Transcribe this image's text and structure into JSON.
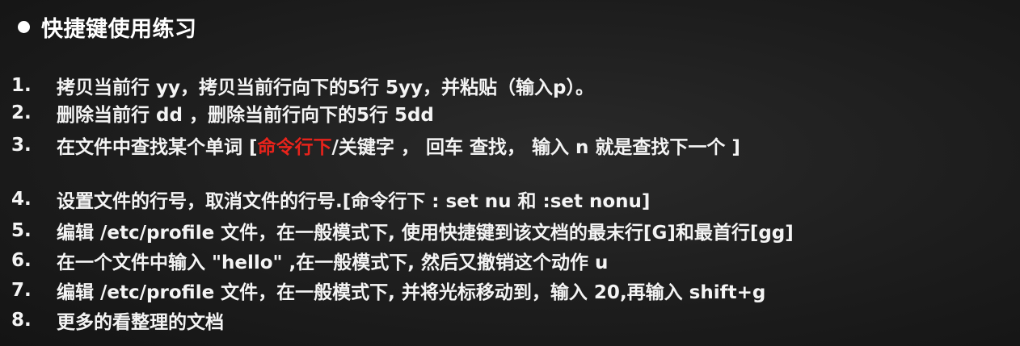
{
  "heading": "快捷键使用练习",
  "items": [
    {
      "num": "1.",
      "text": "拷贝当前行   yy，拷贝当前行向下的5行  5yy，并粘贴（输入p）。"
    },
    {
      "num": "2.",
      "text": "删除当前行  dd ，删除当前行向下的5行 5dd"
    },
    {
      "num": "3.",
      "text_before": "在文件中查找某个单词 [",
      "highlight": "命令行下",
      "text_after": " /关键字  ， 回车 查找， 输入 n 就是查找下一个 ]"
    },
    {
      "num": "4.",
      "text": "设置文件的行号，取消文件的行号.[命令行下  : set nu 和  :set nonu]"
    },
    {
      "num": "5.",
      "text": "编辑 /etc/profile 文件，在一般模式下, 使用快捷键到该文档的最末行[G]和最首行[gg]"
    },
    {
      "num": "6.",
      "text": "在一个文件中输入 \"hello\" ,在一般模式下, 然后又撤销这个动作  u"
    },
    {
      "num": "7.",
      "text": "编辑  /etc/profile 文件，在一般模式下, 并将光标移动到，输入 20,再输入 shift+g"
    },
    {
      "num": "8.",
      "text": "更多的看整理的文档"
    }
  ],
  "colors": {
    "background": "#1b1b1b",
    "text": "#f4f4f4",
    "highlight": "#e8231b"
  }
}
